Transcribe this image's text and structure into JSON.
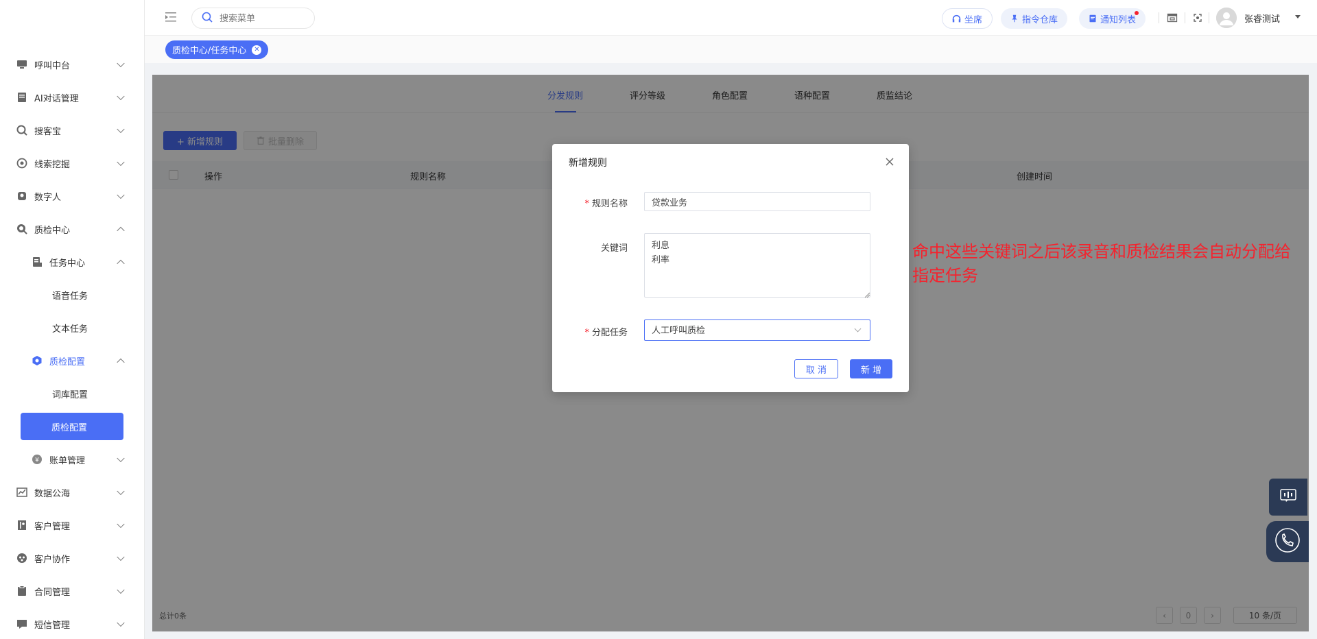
{
  "sidebar": {
    "items": [
      {
        "label": "呼叫中台",
        "icon": "monitor-icon"
      },
      {
        "label": "AI对话管理",
        "icon": "book-icon"
      },
      {
        "label": "搜客宝",
        "icon": "search-circle-icon"
      },
      {
        "label": "线索挖掘",
        "icon": "target-icon"
      },
      {
        "label": "数字人",
        "icon": "digital-human-icon"
      },
      {
        "label": "质检中心",
        "icon": "inspection-icon"
      }
    ],
    "task_center": {
      "label": "任务中心"
    },
    "voice_task": "语音任务",
    "text_task": "文本任务",
    "qc_config_group": "质检配置",
    "lexicon_config": "词库配置",
    "qc_config_selected": "质检配置",
    "billing": "账单管理",
    "bottom_items": [
      {
        "label": "数据公海"
      },
      {
        "label": "客户管理"
      },
      {
        "label": "客户协作"
      },
      {
        "label": "合同管理"
      },
      {
        "label": "短信管理"
      }
    ]
  },
  "header": {
    "search_placeholder": "搜索菜单",
    "seat_label": "坐席",
    "command_label": "指令仓库",
    "notice_label": "通知列表",
    "username": "张睿测试"
  },
  "tagbar": {
    "tag_label": "质检中心/任务中心"
  },
  "tabs": [
    "分发规则",
    "评分等级",
    "角色配置",
    "语种配置",
    "质监结论"
  ],
  "toolbar": {
    "add_rule": "+ 新增规则",
    "batch_delete": "批量删除"
  },
  "table": {
    "columns": [
      "操作",
      "规则名称",
      "创建时间"
    ],
    "total": "总计0条",
    "page": "0",
    "page_size": "10 条/页"
  },
  "modal": {
    "title": "新增规则",
    "rule_name_label": "规则名称",
    "rule_name_value": "贷款业务",
    "keyword_label": "关键词",
    "keywords_value": "利息\n利率",
    "task_label": "分配任务",
    "task_value": "人工呼叫质检",
    "cancel": "取 消",
    "submit": "新 增"
  },
  "annotation": "命中这些关键词之后该录音和质检结果会自动分配给指定任务",
  "colors": {
    "primary": "#4a6ef5",
    "required": "#f5222d",
    "annotation": "#f5222d",
    "float_bg": "#2b3a55"
  }
}
